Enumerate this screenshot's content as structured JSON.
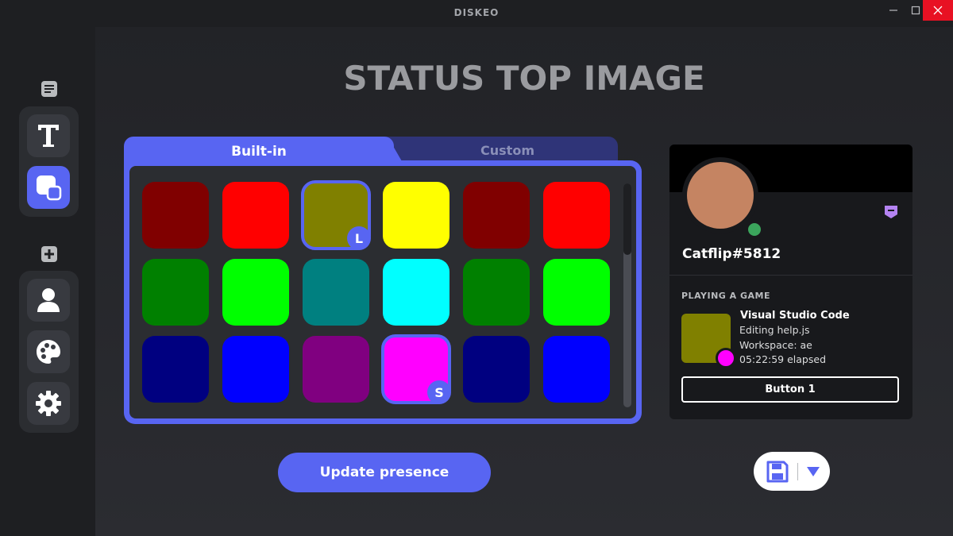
{
  "app": {
    "title": "DISKEO"
  },
  "window_controls": {
    "minimize": "–",
    "maximize": "☐",
    "close": "✕"
  },
  "sidebar": {
    "groups": [
      {
        "header_icon": "document-icon",
        "items": [
          {
            "name": "text-icon",
            "active": false
          },
          {
            "name": "image-icon",
            "active": true
          }
        ]
      },
      {
        "header_icon": "plus-icon",
        "items": [
          {
            "name": "user-icon",
            "active": false
          },
          {
            "name": "palette-icon",
            "active": false
          },
          {
            "name": "gear-icon",
            "active": false
          }
        ]
      }
    ]
  },
  "page": {
    "title": "STATUS TOP IMAGE"
  },
  "tabs": [
    {
      "label": "Built-in",
      "active": true
    },
    {
      "label": "Custom",
      "active": false
    }
  ],
  "swatches": [
    {
      "color": "#800000"
    },
    {
      "color": "#ff0000"
    },
    {
      "color": "#808000",
      "badge": "L"
    },
    {
      "color": "#ffff00"
    },
    {
      "color": "#800000"
    },
    {
      "color": "#ff0000"
    },
    {
      "color": "#008000"
    },
    {
      "color": "#00ff00"
    },
    {
      "color": "#008080"
    },
    {
      "color": "#00ffff"
    },
    {
      "color": "#008000"
    },
    {
      "color": "#00ff00"
    },
    {
      "color": "#000080"
    },
    {
      "color": "#0000ff"
    },
    {
      "color": "#800080"
    },
    {
      "color": "#ff00ff",
      "badge": "S"
    },
    {
      "color": "#000080"
    },
    {
      "color": "#0000ff"
    }
  ],
  "actions": {
    "update_label": "Update presence"
  },
  "profile": {
    "username": "Catflip#5812",
    "status": "online",
    "activity": {
      "header": "PLAYING A GAME",
      "name": "Visual Studio Code",
      "details": "Editing help.js",
      "state": "Workspace: ae",
      "elapsed": "05:22:59 elapsed",
      "large_image_color": "#808000",
      "small_image_color": "#ff00ff"
    },
    "button_label": "Button 1"
  },
  "colors": {
    "accent": "#5865f2",
    "background": "#27282d",
    "card": "#18191c"
  }
}
